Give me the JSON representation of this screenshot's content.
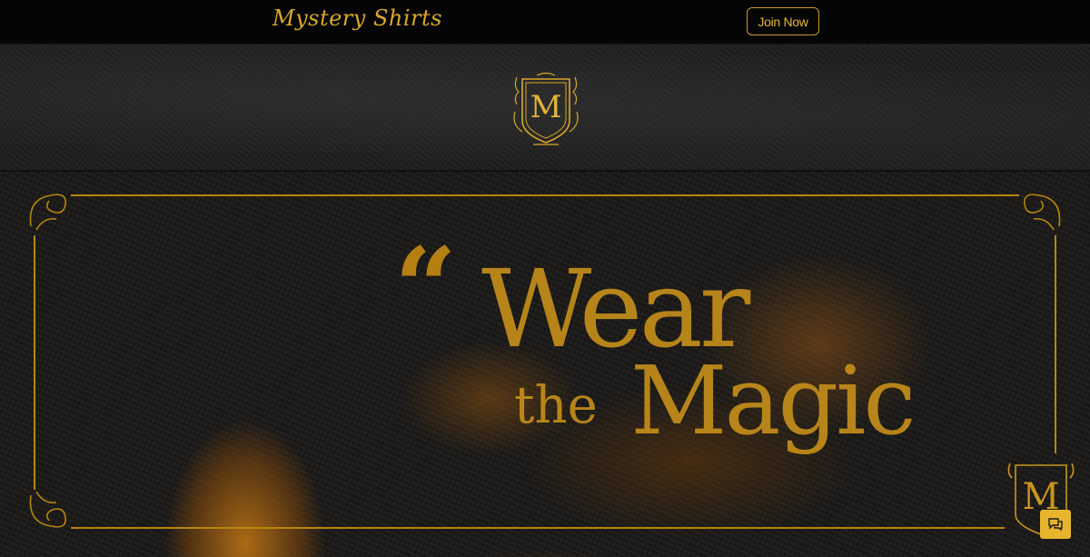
{
  "header": {
    "brand": "Mystery Shirts",
    "join_label": "Join Now"
  },
  "crest": {
    "letter": "M"
  },
  "hero": {
    "quote_mark": "“",
    "line1": "Wear",
    "line2a": "the",
    "line2b": "Magic",
    "badge_letter": "M"
  },
  "chat": {
    "icon": "chat-bubble-icon"
  },
  "colors": {
    "gold": "#c7901a",
    "button_gold": "#e7b52d",
    "background": "#0a0a0a"
  }
}
